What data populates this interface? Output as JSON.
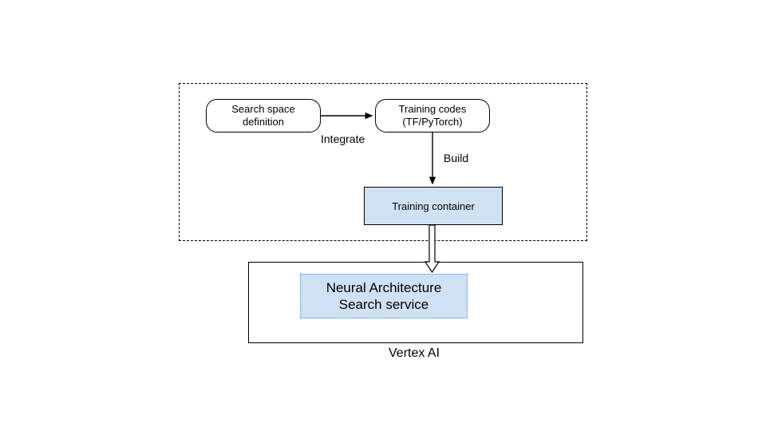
{
  "nodes": {
    "search_space": "Search space\ndefinition",
    "training_codes": "Training codes\n(TF/PyTorch)",
    "training_container": "Training container",
    "nas_service": "Neural Architecture\nSearch service",
    "vertex_label": "Vertex AI"
  },
  "edges": {
    "integrate": "Integrate",
    "build": "Build"
  },
  "colors": {
    "blue_fill": "#cfe2f3",
    "dotted_border": "#4a86e8"
  }
}
